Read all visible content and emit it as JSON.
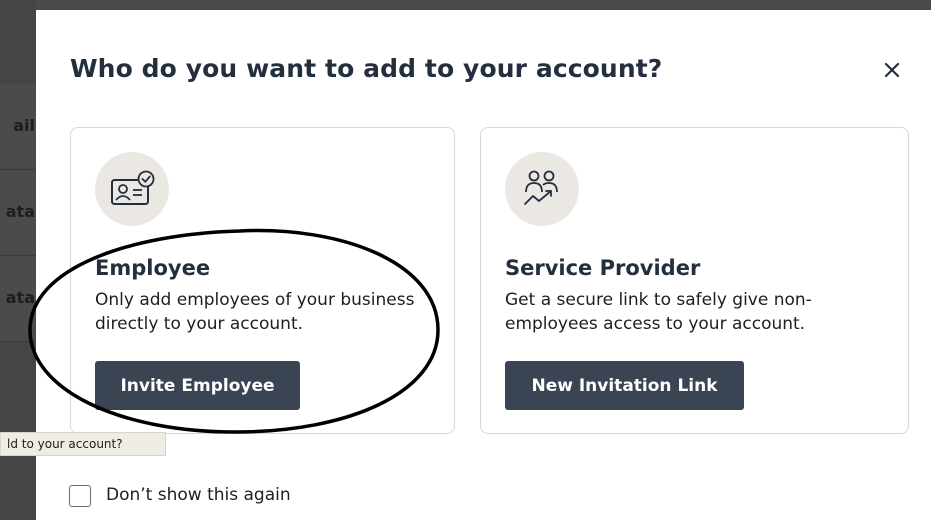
{
  "backdrop": {
    "fragments": [
      "ail",
      "ata",
      "ata"
    ]
  },
  "modal": {
    "title": "Who do you want to add to your account?",
    "close_label": "×"
  },
  "cards": {
    "employee": {
      "icon": "id-card-icon",
      "title": "Employee",
      "description": "Only add employees of your business directly to your account.",
      "button_label": "Invite Employee"
    },
    "provider": {
      "icon": "service-provider-icon",
      "title": "Service Provider",
      "description": "Get a secure link to safely give non-employees access to your account.",
      "button_label": "New Invitation Link"
    }
  },
  "tooltip": {
    "text": "ld to your account?"
  },
  "dont_show": {
    "label": "Don’t show this again",
    "checked": false
  },
  "colors": {
    "primary_button": "#3a4453",
    "title_text": "#232f3e",
    "icon_circle": "#ebe8e4",
    "card_border": "#d5d9d9"
  }
}
